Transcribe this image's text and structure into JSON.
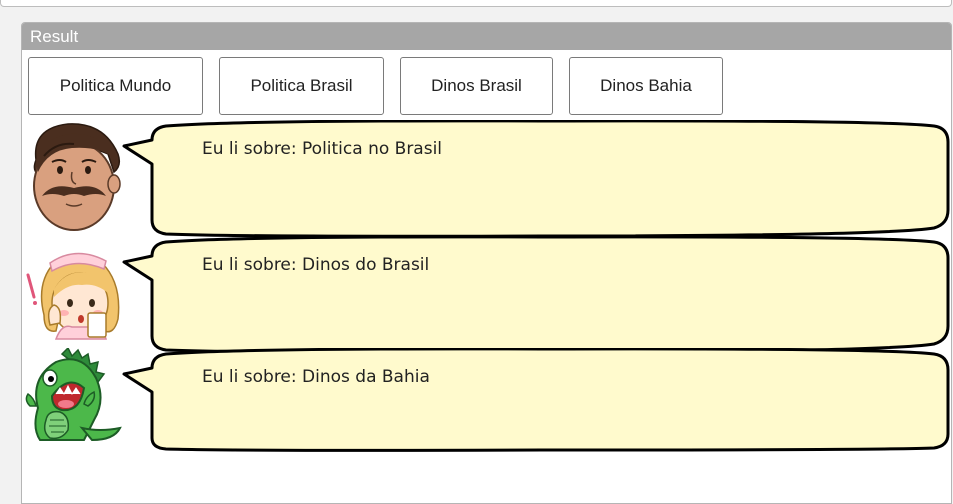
{
  "panel": {
    "title": "Result"
  },
  "buttons": [
    {
      "label": "Politica Mundo"
    },
    {
      "label": "Politica Brasil"
    },
    {
      "label": "Dinos Brasil"
    },
    {
      "label": "Dinos Bahia"
    }
  ],
  "messages": [
    {
      "avatar": "man-mustache-icon",
      "text": "Eu li sobre: Politica no Brasil"
    },
    {
      "avatar": "nurse-girl-icon",
      "text": "Eu li sobre: Dinos do Brasil"
    },
    {
      "avatar": "green-dinosaur-icon",
      "text": "Eu li sobre: Dinos da Bahia"
    }
  ],
  "colors": {
    "bubble_fill": "#fffacd",
    "bubble_stroke": "#000000",
    "header_bg": "#a6a6a6"
  }
}
